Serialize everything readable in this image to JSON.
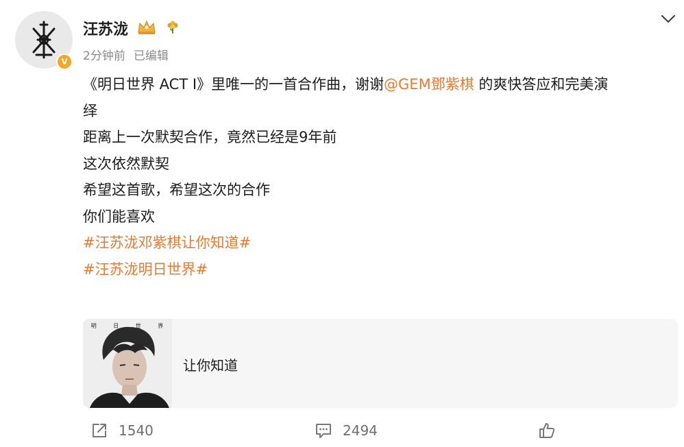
{
  "post": {
    "author": "汪苏泷",
    "time": "2分钟前",
    "edited": "已编辑",
    "content": {
      "line1_a": "《明日世界 ACT I》里唯一的一首合作曲，谢谢",
      "line1_mention": "@GEM鄧紫棋",
      "line1_b": " 的爽快答应和完美演",
      "line2": "绎",
      "line3": "距离上一次默契合作，竟然已经是9年前",
      "line4": "这次依然默契",
      "line5": "希望这首歌，希望这次的合作",
      "line6": "你们能喜欢",
      "tag1": "#汪苏泷邓紫棋让你知道#",
      "tag2": "#汪苏泷明日世界#"
    }
  },
  "music_card": {
    "cover_caption": [
      "明",
      "日",
      "世",
      "界"
    ],
    "song_title": "让你知道"
  },
  "actions": {
    "repost_count": "1540",
    "comment_count": "2494"
  },
  "colors": {
    "accent": "#e77a30",
    "verified": "#f5a623",
    "meta_text": "#8a8a8a"
  },
  "icons": {
    "avatar": "avatar-logo",
    "verified": "verified-badge-icon",
    "crown": "crown-badge-icon",
    "flower": "flower-badge-icon",
    "more": "chevron-down-icon",
    "repost": "repost-icon",
    "comment": "comment-icon",
    "like": "like-icon"
  }
}
